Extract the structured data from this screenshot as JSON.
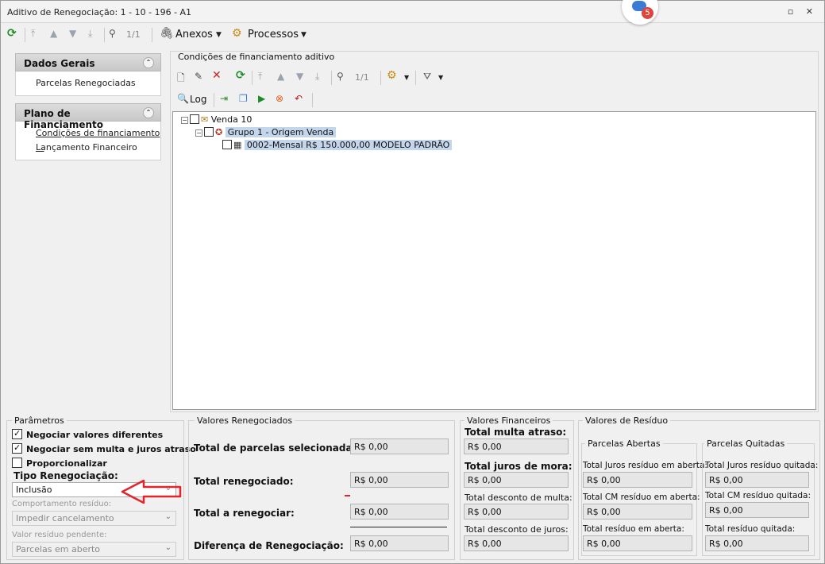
{
  "window": {
    "title": "Aditivo de Renegociação: 1 - 10 - 196 - A1",
    "controls": "▫ ✕"
  },
  "notification": {
    "count": "5"
  },
  "toolbar": {
    "counter": "1/1",
    "anexos": "Anexos",
    "processos": "Processos"
  },
  "sidebar": {
    "groups": [
      {
        "title": "Dados Gerais",
        "items": [
          "Parcelas Renegociadas"
        ]
      },
      {
        "title": "Plano de Financiamento",
        "items": [
          "Condições de financiamento ...",
          "Lançamento Financeiro"
        ]
      }
    ]
  },
  "conditions": {
    "legend": "Condições de financiamento aditivo",
    "counter": "1/1",
    "log_label": "Log",
    "tree": {
      "root": "Venda 10",
      "group": "Grupo 1 - Origem Venda",
      "item": "0002-Mensal  R$ 150.000,00  MODELO PADRÃO"
    }
  },
  "parametros": {
    "legend": "Parâmetros",
    "opt1": "Negociar valores diferentes",
    "opt2": "Negociar sem multa e juros atraso",
    "opt3": "Proporcionalizar",
    "tipo_label": "Tipo Renegociação:",
    "tipo_value": "Inclusão",
    "comp_label": "Comportamento resíduo:",
    "comp_value": "Impedir cancelamento",
    "valor_label": "Valor resíduo pendente:",
    "valor_value": "Parcelas em aberto"
  },
  "valores_renegociados": {
    "legend": "Valores Renegociados",
    "rows": [
      {
        "label": "Total de parcelas selecionadas:",
        "value": "R$ 0,00"
      },
      {
        "label": "Total renegociado:",
        "value": "R$ 0,00"
      },
      {
        "label": "Total a renegociar:",
        "value": "R$ 0,00"
      },
      {
        "label": "Diferença de Renegociação:",
        "value": "R$ 0,00"
      }
    ]
  },
  "valores_financeiros": {
    "legend": "Valores Financeiros",
    "rows": [
      {
        "label": "Total multa atraso:",
        "value": "R$ 0,00"
      },
      {
        "label": "Total juros de mora:",
        "value": "R$ 0,00"
      },
      {
        "label": "Total desconto de multa:",
        "value": "R$ 0,00"
      },
      {
        "label": "Total desconto de juros:",
        "value": "R$ 0,00"
      }
    ]
  },
  "valores_residuo": {
    "legend": "Valores de Resíduo",
    "abertas": {
      "legend": "Parcelas Abertas",
      "rows": [
        {
          "label": "Total Juros resíduo em aberta:",
          "value": "R$ 0,00"
        },
        {
          "label": "Total CM resíduo em aberta:",
          "value": "R$ 0,00"
        },
        {
          "label": "Total resíduo em aberta:",
          "value": "R$ 0,00"
        }
      ]
    },
    "quitadas": {
      "legend": "Parcelas Quitadas",
      "rows": [
        {
          "label": "Total Juros resíduo quitada:",
          "value": "R$ 0,00"
        },
        {
          "label": "Total CM resíduo quitada:",
          "value": "R$ 0,00"
        },
        {
          "label": "Total resíduo quitada:",
          "value": "R$ 0,00"
        }
      ]
    }
  },
  "colors": {
    "annotation_arrow": "#e0252c",
    "selection": "#c3d6ec"
  }
}
